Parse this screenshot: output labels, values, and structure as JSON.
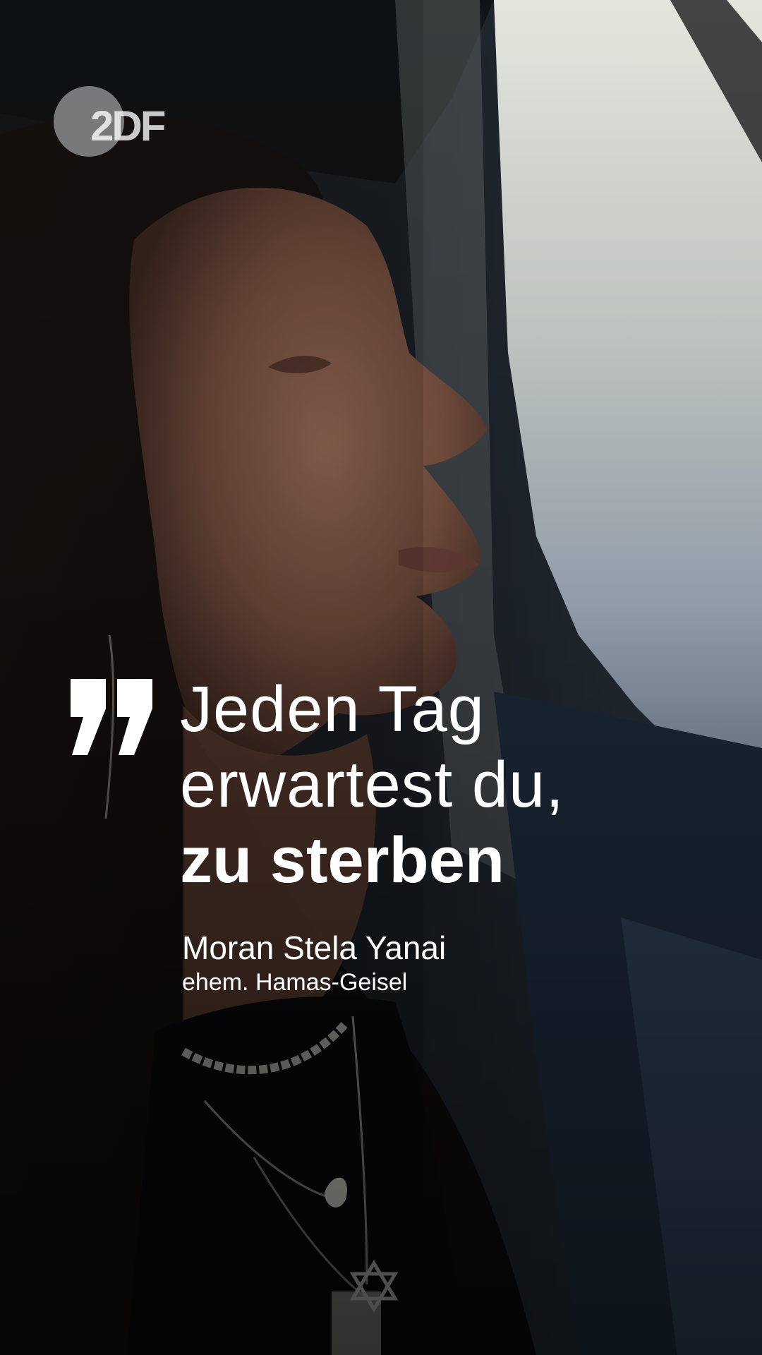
{
  "logo": {
    "text": "2DF"
  },
  "quote": {
    "line1": "Jeden Tag",
    "line2": "erwartest du,",
    "line3": "zu sterben"
  },
  "attribution": {
    "name": "Moran Stela Yanai",
    "role": "ehem. Hamas-Geisel"
  },
  "colors": {
    "text": "#ffffff",
    "logo": "#c8c8c8"
  }
}
